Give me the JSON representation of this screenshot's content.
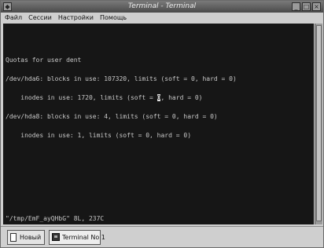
{
  "window": {
    "title": "Terminal - Terminal",
    "buttons": [
      "◆",
      "_",
      "□",
      "×"
    ]
  },
  "menubar": {
    "items": [
      "Файл",
      "Сессии",
      "Настройки",
      "Помощь"
    ]
  },
  "terminal": {
    "lines": [
      "",
      "Quotas for user dent",
      "/dev/hda6: blocks in use: 107320, limits (soft = 0, hard = 0)",
      "    inodes in use: 1720, limits (soft = ",
      "/dev/hda8: blocks in use: 4, limits (soft = 0, hard = 0)",
      "    inodes in use: 1, limits (soft = 0, hard = 0)"
    ],
    "cursor_char": "0",
    "cursor_line_suffix": ", hard = 0)",
    "status_line": "\"/tmp/EmF_ayQHbG\" 8L, 237C"
  },
  "tabbar": {
    "new_label": "Новый",
    "tab_label": "Terminal No 1"
  }
}
